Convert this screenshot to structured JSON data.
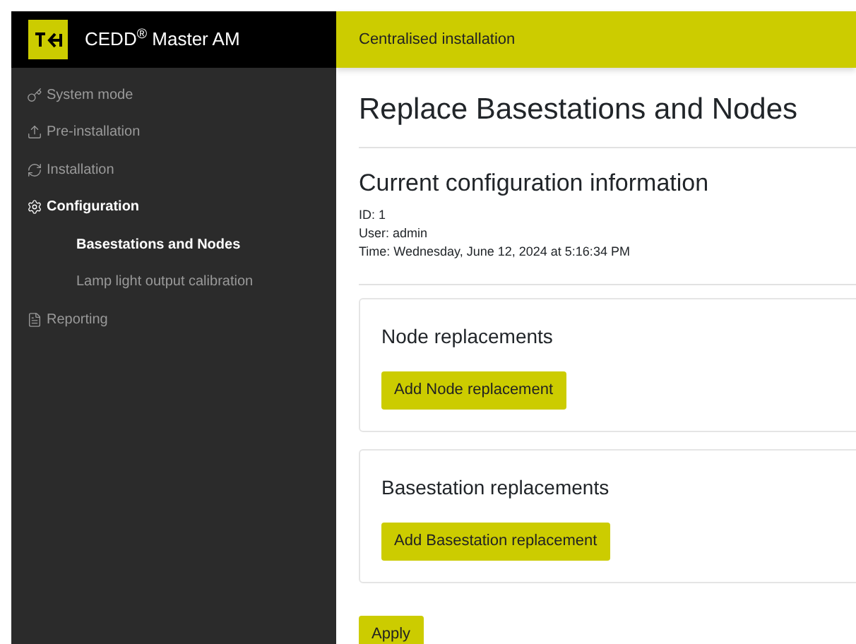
{
  "app": {
    "title": "CEDD$^{®}$ Master AM"
  },
  "topbar": {
    "title": "Centralised installation"
  },
  "sidebar": {
    "items": [
      {
        "label": "System mode",
        "selected": false
      },
      {
        "label": "Pre-installation",
        "selected": false
      },
      {
        "label": "Installation",
        "selected": false
      },
      {
        "label": "Configuration",
        "selected": true,
        "children": [
          {
            "label": "Basestations and Nodes",
            "selected": true
          },
          {
            "label": "Lamp light output calibration",
            "selected": false
          }
        ]
      },
      {
        "label": "Reporting",
        "selected": false
      }
    ]
  },
  "page": {
    "title": "Replace Basestations and Nodes",
    "info": {
      "title": "Current configuration information",
      "lines": [
        "ID: 1",
        "User: admin",
        "Time: Wednesday, June 12, 2024 at 5:16:34 PM"
      ]
    },
    "cards": [
      {
        "title": "Node replacements",
        "button": "Add Node replacement"
      },
      {
        "title": "Basestation replacements",
        "button": "Add Basestation replacement"
      }
    ],
    "apply_button": "Apply"
  }
}
